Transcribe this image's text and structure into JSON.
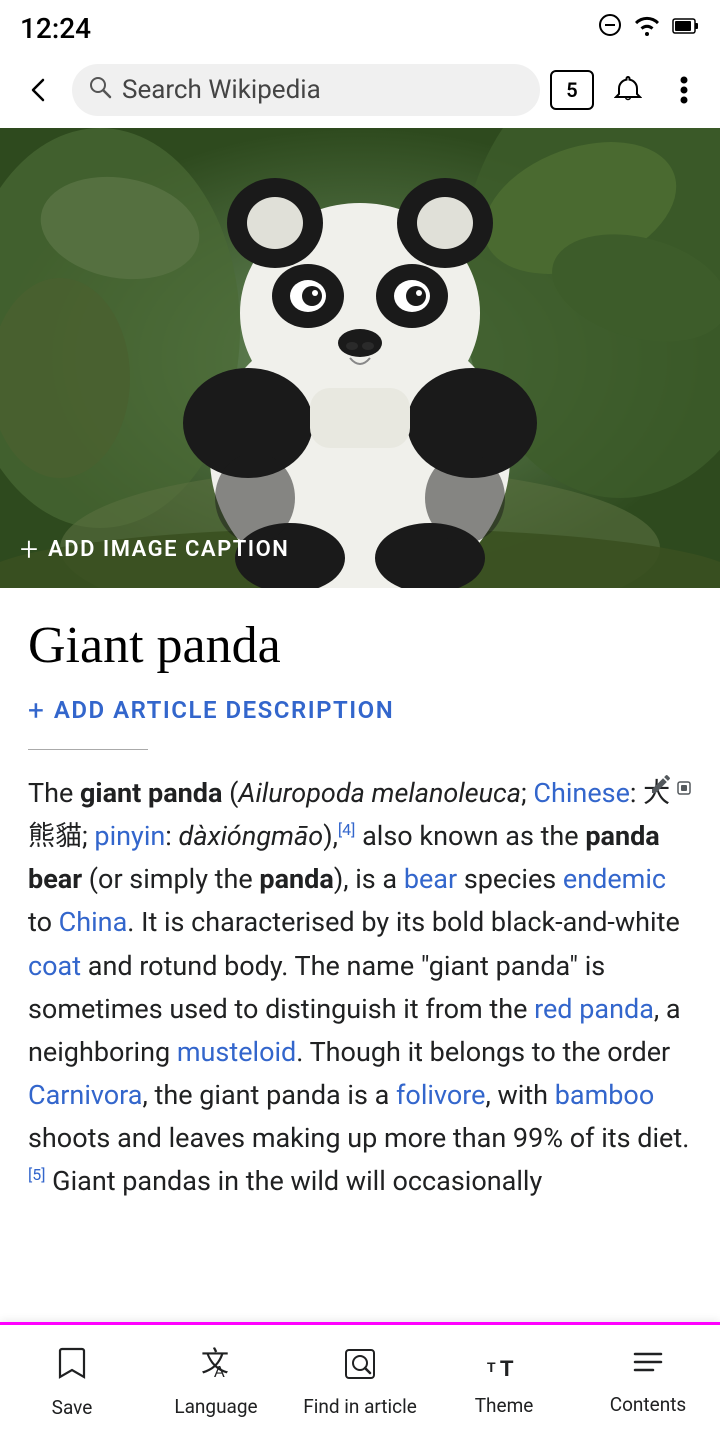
{
  "statusBar": {
    "time": "12:24",
    "icons": [
      "do-not-disturb",
      "wifi",
      "battery"
    ]
  },
  "topBar": {
    "backLabel": "←",
    "searchPlaceholder": "Search Wikipedia",
    "tabCount": "5",
    "bellLabel": "🔔",
    "menuLabel": "⋮"
  },
  "heroImage": {
    "altText": "Giant panda in natural habitat",
    "addCaptionLabel": "ADD IMAGE CAPTION",
    "addCaptionPlus": "+"
  },
  "article": {
    "title": "Giant panda",
    "addDescriptionPlus": "+",
    "addDescriptionLabel": "ADD ARTICLE DESCRIPTION",
    "body": {
      "intro": "The giant panda (Ailuropoda melanoleuca; Chinese: 大熊貓; pinyin: dàxióngmāo),[4] also known as the panda bear (or simply the panda), is a bear species endemic to China. It is characterised by its bold black-and-white coat and rotund body. The name \"giant panda\" is sometimes used to distinguish it from the red panda, a neighboring musteloid. Though it belongs to the order Carnivora, the giant panda is a folivore, with bamboo shoots and leaves making up more than 99% of its diet.[5] Giant pandas in the wild will occasionally"
    }
  },
  "bottomNav": {
    "items": [
      {
        "id": "save",
        "label": "Save",
        "icon": "bookmark"
      },
      {
        "id": "language",
        "label": "Language",
        "icon": "translate"
      },
      {
        "id": "find",
        "label": "Find in article",
        "icon": "find-in-article"
      },
      {
        "id": "theme",
        "label": "Theme",
        "icon": "text-size"
      },
      {
        "id": "contents",
        "label": "Contents",
        "icon": "list"
      }
    ]
  }
}
